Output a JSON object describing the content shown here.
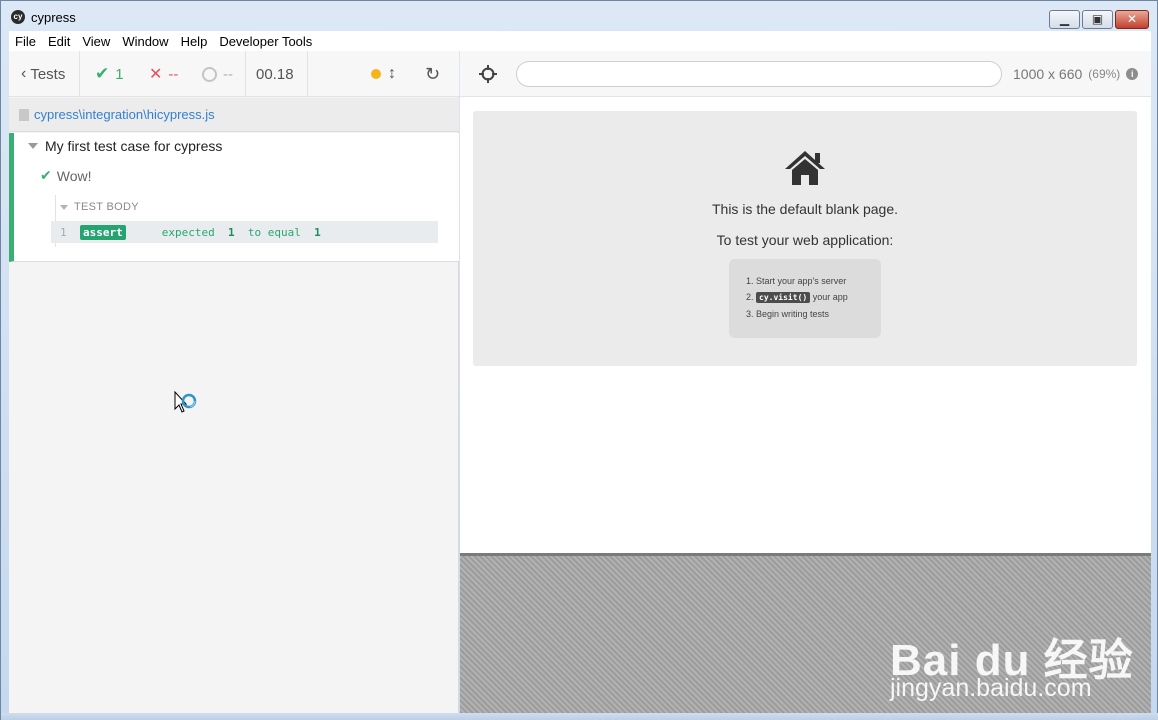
{
  "window": {
    "title": "cypress",
    "app_icon": "cy"
  },
  "menu": {
    "items": [
      "File",
      "Edit",
      "View",
      "Window",
      "Help",
      "Developer Tools"
    ]
  },
  "reporter": {
    "header": {
      "back_label": "Tests",
      "passed": "1",
      "failed": "--",
      "pending": "--",
      "duration": "00.18"
    },
    "spec_path": "cypress\\integration\\hicypress.js",
    "suite_title": "My first test case for cypress",
    "test_title": "Wow!",
    "hook_label": "TEST BODY",
    "command": {
      "number": "1",
      "name": "assert",
      "msg_prefix": "expected",
      "msg_val1": "1",
      "msg_mid": "to equal",
      "msg_val2": "1"
    }
  },
  "aut": {
    "url_value": "",
    "viewport_size": "1000 x 660",
    "viewport_scale": "(69%)",
    "blank_page": {
      "line1": "This is the default blank page.",
      "line2": "To test your web application:",
      "step1": "1. Start your app's server",
      "step2_prefix": "2.",
      "step2_code": "cy.visit()",
      "step2_suffix": "your app",
      "step3": "3. Begin writing tests"
    }
  },
  "watermark": {
    "brand": "Bai du 经验",
    "domain": "jingyan.baidu.com"
  },
  "colors": {
    "pass": "#3bae73",
    "fail": "#e94f5f",
    "link": "#3380d0",
    "running": "#f4b51a"
  }
}
